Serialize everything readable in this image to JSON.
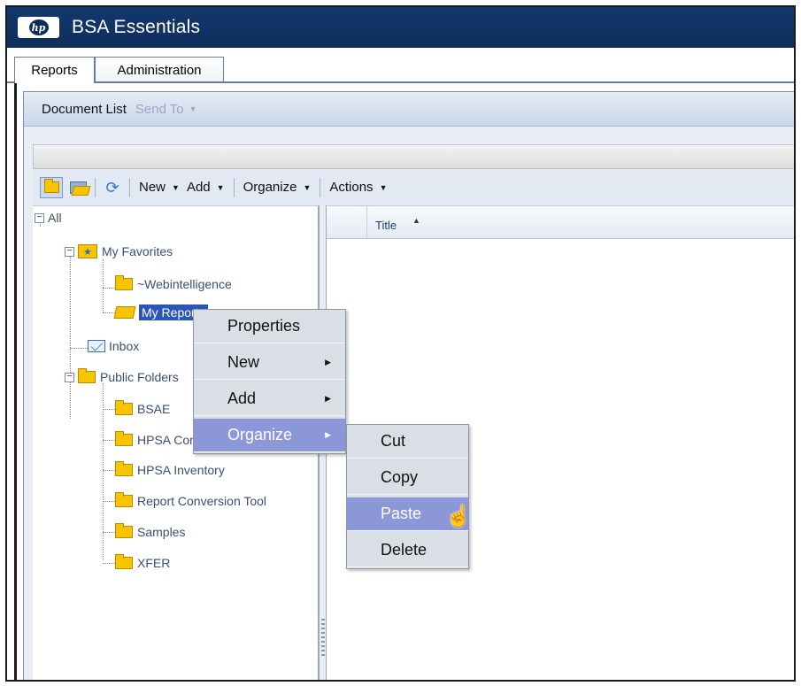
{
  "window": {
    "title": "BSA Essentials",
    "logo_text": "hp"
  },
  "tabs": [
    {
      "label": "Reports",
      "active": true
    },
    {
      "label": "Administration",
      "active": false
    }
  ],
  "doclist": {
    "title": "Document List",
    "send_to": "Send To"
  },
  "toolbar": {
    "icons": [
      "folder-icon",
      "open-folder-icon",
      "refresh-icon"
    ],
    "menus": [
      "New",
      "Add",
      "Organize",
      "Actions"
    ]
  },
  "tree": {
    "root": "All",
    "favorites": "My Favorites",
    "webintelligence": "~Webintelligence",
    "my_reports": "My Reports",
    "inbox": "Inbox",
    "public_folders": "Public Folders",
    "public_children": [
      "BSAE",
      "HPSA Compliance",
      "HPSA Inventory",
      "Report Conversion Tool",
      "Samples",
      "XFER"
    ]
  },
  "list": {
    "column_title": "Title"
  },
  "context_menu": {
    "items": [
      {
        "label": "Properties",
        "submenu": false,
        "highlighted": false
      },
      {
        "label": "New",
        "submenu": true,
        "highlighted": false
      },
      {
        "label": "Add",
        "submenu": true,
        "highlighted": false
      },
      {
        "label": "Organize",
        "submenu": true,
        "highlighted": true
      }
    ]
  },
  "organize_submenu": {
    "items": [
      {
        "label": "Cut",
        "highlighted": false
      },
      {
        "label": "Copy",
        "highlighted": false
      },
      {
        "label": "Paste",
        "highlighted": true
      },
      {
        "label": "Delete",
        "highlighted": false
      }
    ]
  },
  "colors": {
    "titlebar": "#0e2d5c",
    "selection": "#2b55b8",
    "menu_highlight": "#8b97d6",
    "folder": "#f7c400"
  }
}
